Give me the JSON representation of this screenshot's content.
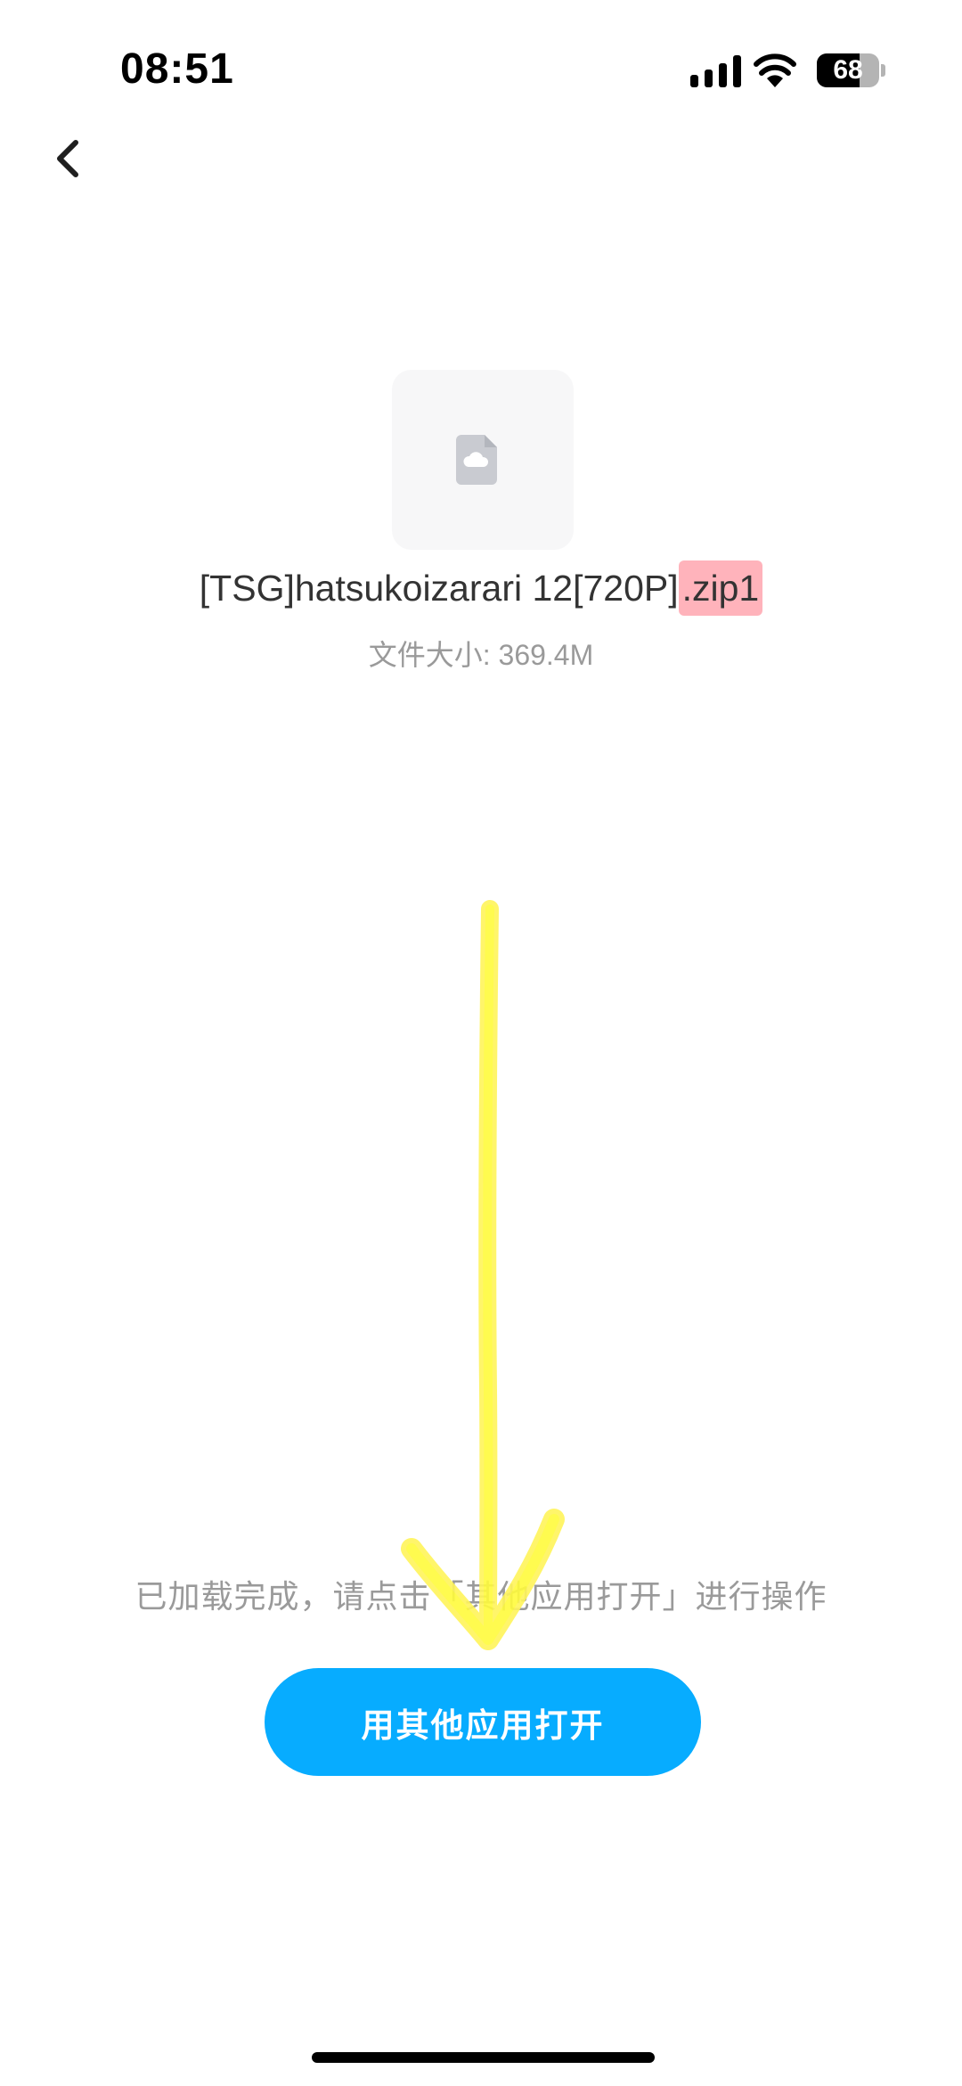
{
  "status_bar": {
    "time": "08:51",
    "battery": "68",
    "battery_level": 0.68,
    "icons": [
      "cellular-signal-icon",
      "wifi-icon",
      "battery-icon"
    ]
  },
  "nav": {
    "back_icon": "chevron-left-icon"
  },
  "file": {
    "icon": "cloud-file-icon",
    "name_prefix": "[TSG]hatsukoizarari 12[720P]",
    "name_ext": ".zip1",
    "size": "文件大小: 369.4M"
  },
  "hint": "已加载完成，请点击「其他应用打开」进行操作",
  "open_button": {
    "label": "用其他应用打开"
  },
  "colors": {
    "accent": "#07acff",
    "highlight": "#ffb3bb",
    "annotation_arrow": "#fffb3c"
  }
}
